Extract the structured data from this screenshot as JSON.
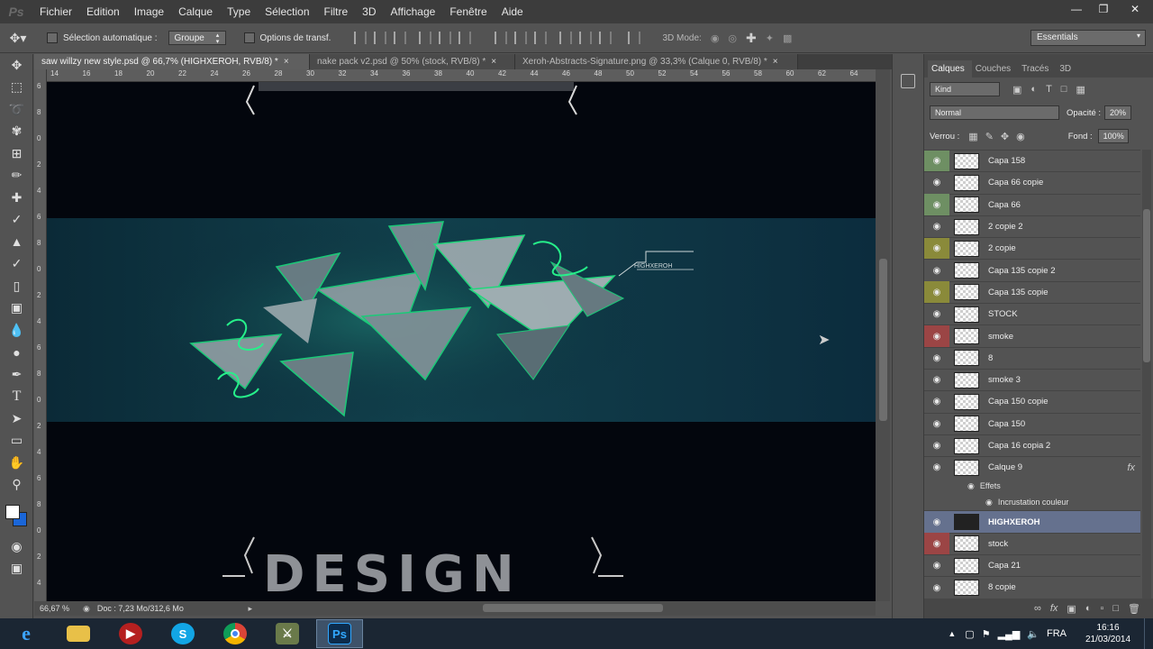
{
  "menubar": {
    "logo": "Ps",
    "items": [
      "Fichier",
      "Edition",
      "Image",
      "Calque",
      "Type",
      "Sélection",
      "Filtre",
      "3D",
      "Affichage",
      "Fenêtre",
      "Aide"
    ]
  },
  "options": {
    "auto_select_label": "Sélection automatique :",
    "auto_select_value": "Groupe",
    "transform_label": "Options de transf.",
    "mode3d_label": "3D Mode:",
    "workspace": "Essentials"
  },
  "tabs": [
    {
      "label": "saw willzy new style.psd @ 66,7% (HIGHXEROH, RVB/8) *",
      "active": true
    },
    {
      "label": "nake pack v2.psd @ 50% (stock, RVB/8) *",
      "active": false
    },
    {
      "label": "Xeroh-Abstracts-Signature.png @ 33,3% (Calque 0, RVB/8) *",
      "active": false
    }
  ],
  "rulers": {
    "horizontal": [
      "14",
      "16",
      "18",
      "20",
      "22",
      "24",
      "26",
      "28",
      "30",
      "32",
      "34",
      "36",
      "38",
      "40",
      "42",
      "44",
      "46",
      "48",
      "50",
      "52",
      "54",
      "56",
      "58",
      "60",
      "62",
      "64"
    ],
    "vertical": [
      "6",
      "8",
      "0",
      "2",
      "4",
      "6",
      "8",
      "0",
      "2",
      "4",
      "6",
      "8",
      "0",
      "2",
      "4",
      "6",
      "8",
      "0",
      "2",
      "4"
    ]
  },
  "canvas": {
    "banner_small_text": "HIGHXEROH",
    "design_text": "DESIGN"
  },
  "status": {
    "zoom": "66,67 %",
    "doc": "Doc : 7,23 Mo/312,6 Mo"
  },
  "panel": {
    "tabs": [
      "Calques",
      "Couches",
      "Tracés",
      "3D"
    ],
    "filter_kind": "Kind",
    "blend_mode": "Normal",
    "opacity_label": "Opacité :",
    "opacity_value": "20%",
    "lock_label": "Verrou :",
    "fill_label": "Fond :",
    "fill_value": "100%",
    "effects_label": "Effets",
    "effect_item": "Incrustation couleur",
    "fx_badge": "fx"
  },
  "layers": [
    {
      "name": "Capa 158",
      "eye_color": "#6e8f63"
    },
    {
      "name": "Capa 66 copie",
      "eye_color": ""
    },
    {
      "name": "Capa 66",
      "eye_color": "#6e8f63"
    },
    {
      "name": "2 copie 2",
      "eye_color": ""
    },
    {
      "name": "2 copie",
      "eye_color": "#8a8a3a"
    },
    {
      "name": "Capa 135 copie 2",
      "eye_color": ""
    },
    {
      "name": "Capa 135 copie",
      "eye_color": "#8a8a3a"
    },
    {
      "name": "STOCK",
      "eye_color": ""
    },
    {
      "name": "smoke",
      "eye_color": "#9b4545"
    },
    {
      "name": "8",
      "eye_color": ""
    },
    {
      "name": "smoke 3",
      "eye_color": ""
    },
    {
      "name": "Capa 150 copie",
      "eye_color": ""
    },
    {
      "name": "Capa 150",
      "eye_color": ""
    },
    {
      "name": "Capa 16 copia 2",
      "eye_color": ""
    },
    {
      "name": "Calque 9",
      "eye_color": ""
    }
  ],
  "layers_after": [
    {
      "name": "HIGHXEROH",
      "eye_color": "",
      "selected": true
    },
    {
      "name": "stock",
      "eye_color": "#9b4545"
    },
    {
      "name": "Capa 21",
      "eye_color": ""
    },
    {
      "name": "8 copie",
      "eye_color": ""
    }
  ],
  "taskbar": {
    "apps": [
      "ie-icon",
      "folder-icon",
      "media-icon",
      "skype-icon",
      "chrome-icon",
      "gamer-icon",
      "photoshop-icon"
    ],
    "ps_label": "Ps",
    "language": "FRA",
    "time": "16:16",
    "date": "21/03/2014"
  }
}
